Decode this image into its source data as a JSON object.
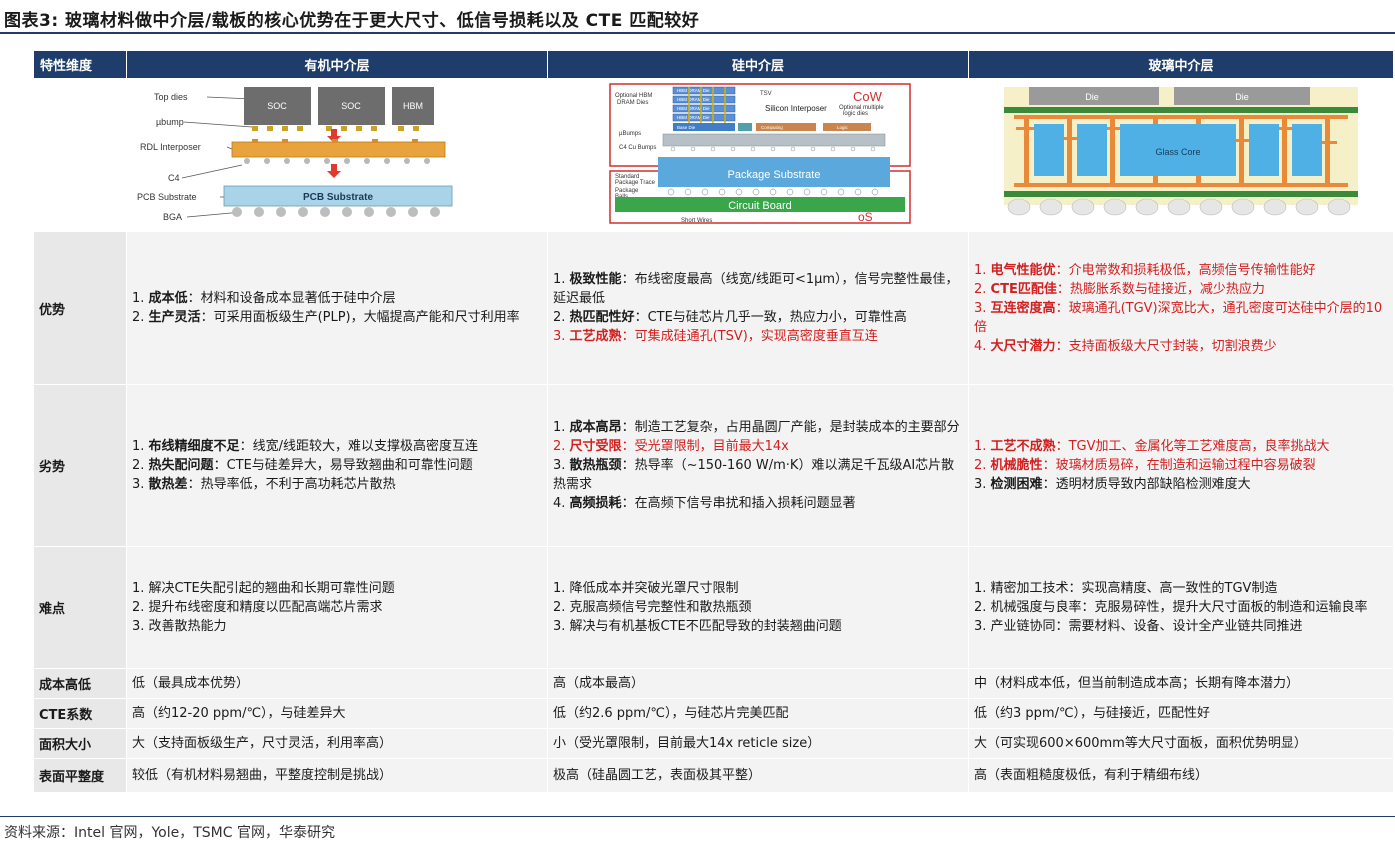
{
  "title": "图表3:  玻璃材料做中介层/载板的核心优势在于更大尺寸、低信号损耗以及 CTE 匹配较好",
  "columns": [
    "特性维度",
    "有机中介层",
    "硅中介层",
    "玻璃中介层"
  ],
  "diagrams": {
    "organic": {
      "top_dies": "Top dies",
      "ubump": "µbump",
      "rdl": "RDL Interposer",
      "c4": "C4",
      "pcb": "PCB Substrate",
      "bga": "BGA",
      "soc1": "SOC",
      "soc2": "SOC",
      "hbm": "HBM",
      "pcb_inner": "PCB Substrate"
    },
    "silicon": {
      "cow": "CoW",
      "os": "oS",
      "optional_hbm": "Optional HBM",
      "dram_dies": "DRAM Dies",
      "tsv": "TSV",
      "silicon_interposer": "Silicon Interposer",
      "optional_multiple": "Optional multiple",
      "logic_dies": "logic dies",
      "ubumps": "µBumps",
      "c4cu": "C4 Cu Bumps",
      "standard": "Standard",
      "package_trace": "Package Trace",
      "package": "Package",
      "balls": "Balls",
      "package_substrate": "Package Substrate",
      "circuit_board": "Circuit Board",
      "short_wires": "Short Wires",
      "hbm_dram_die": "HBM DRAM Die",
      "base_die": "Base Die",
      "computing": "Computing",
      "logic": "Logic"
    },
    "glass": {
      "die1": "Die",
      "die2": "Die",
      "glass_core": "Glass Core"
    }
  },
  "rows": [
    {
      "label": "优势",
      "organic": [
        [
          {
            "t": "1. "
          },
          {
            "t": "成本低",
            "b": true
          },
          {
            "t": "：材料和设备成本显著低于硅中介层"
          }
        ],
        [
          {
            "t": "2. "
          },
          {
            "t": "生产灵活",
            "b": true
          },
          {
            "t": "：可采用面板级生产(PLP)，大幅提高产能和尺寸利用率"
          }
        ]
      ],
      "silicon": [
        [
          {
            "t": "1. "
          },
          {
            "t": "极致性能",
            "b": true
          },
          {
            "t": "：布线密度最高（线宽/线距可<1μm），信号完整性最佳，延迟最低"
          }
        ],
        [
          {
            "t": "2. "
          },
          {
            "t": "热匹配性好",
            "b": true
          },
          {
            "t": "：CTE与硅芯片几乎一致，热应力小，可靠性高"
          }
        ],
        [
          {
            "t": "3. ",
            "r": true
          },
          {
            "t": "工艺成熟",
            "b": true,
            "r": true
          },
          {
            "t": "：可集成硅通孔(TSV)，实现高密度垂直互连",
            "r": true
          }
        ]
      ],
      "glass": [
        [
          {
            "t": "1. ",
            "r": true
          },
          {
            "t": "电气性能优",
            "b": true,
            "r": true
          },
          {
            "t": "：介电常数和损耗极低，高频信号传输性能好",
            "r": true
          }
        ],
        [
          {
            "t": "2. ",
            "r": true
          },
          {
            "t": "CTE匹配佳",
            "b": true,
            "r": true
          },
          {
            "t": "：热膨胀系数与硅接近，减少热应力",
            "r": true
          }
        ],
        [
          {
            "t": "3. ",
            "r": true
          },
          {
            "t": "互连密度高",
            "b": true,
            "r": true
          },
          {
            "t": "：玻璃通孔(TGV)深宽比大，通孔密度可达硅中介层的10倍",
            "r": true
          }
        ],
        [
          {
            "t": "4. ",
            "r": true
          },
          {
            "t": "大尺寸潜力",
            "b": true,
            "r": true
          },
          {
            "t": "：支持面板级大尺寸封装，切割浪费少",
            "r": true
          }
        ]
      ]
    },
    {
      "label": "劣势",
      "organic": [
        [
          {
            "t": "1. "
          },
          {
            "t": "布线精细度不足",
            "b": true
          },
          {
            "t": "：线宽/线距较大，难以支撑极高密度互连"
          }
        ],
        [
          {
            "t": "2. "
          },
          {
            "t": "热失配问题",
            "b": true
          },
          {
            "t": "：CTE与硅差异大，易导致翘曲和可靠性问题"
          }
        ],
        [
          {
            "t": "3. "
          },
          {
            "t": "散热差",
            "b": true
          },
          {
            "t": "：热导率低，不利于高功耗芯片散热"
          }
        ]
      ],
      "silicon": [
        [
          {
            "t": "1. "
          },
          {
            "t": "成本高昂",
            "b": true
          },
          {
            "t": "：制造工艺复杂，占用晶圆厂产能，是封装成本的主要部分"
          }
        ],
        [
          {
            "t": "2. ",
            "r": true
          },
          {
            "t": "尺寸受限",
            "b": true,
            "r": true
          },
          {
            "t": "：受光罩限制，目前最大14x",
            "r": true
          }
        ],
        [
          {
            "t": "3. "
          },
          {
            "t": "散热瓶颈",
            "b": true
          },
          {
            "t": "：热导率（~150-160 W/m·K）难以满足千瓦级AI芯片散热需求"
          }
        ],
        [
          {
            "t": "4. "
          },
          {
            "t": "高频损耗",
            "b": true
          },
          {
            "t": "：在高频下信号串扰和插入损耗问题显著"
          }
        ]
      ],
      "glass": [
        [
          {
            "t": "1. ",
            "r": true
          },
          {
            "t": "工艺不成熟",
            "b": true,
            "r": true
          },
          {
            "t": "：TGV加工、金属化等工艺难度高，良率挑战大",
            "r": true
          }
        ],
        [
          {
            "t": "2. ",
            "r": true
          },
          {
            "t": "机械脆性",
            "b": true,
            "r": true
          },
          {
            "t": "：玻璃材质易碎，在制造和运输过程中容易破裂",
            "r": true
          }
        ],
        [
          {
            "t": "3. "
          },
          {
            "t": "检测困难",
            "b": true
          },
          {
            "t": "：透明材质导致内部缺陷检测难度大"
          }
        ]
      ]
    },
    {
      "label": "难点",
      "organic": [
        [
          {
            "t": "1. 解决CTE失配引起的翘曲和长期可靠性问题"
          }
        ],
        [
          {
            "t": "2. 提升布线密度和精度以匹配高端芯片需求"
          }
        ],
        [
          {
            "t": "3. 改善散热能力"
          }
        ]
      ],
      "silicon": [
        [
          {
            "t": "1. 降低成本并突破光罩尺寸限制"
          }
        ],
        [
          {
            "t": "2. 克服高频信号完整性和散热瓶颈"
          }
        ],
        [
          {
            "t": "3. 解决与有机基板CTE不匹配导致的封装翘曲问题"
          }
        ]
      ],
      "glass": [
        [
          {
            "t": "1. 精密加工技术：实现高精度、高一致性的TGV制造"
          }
        ],
        [
          {
            "t": "2. 机械强度与良率：克服易碎性，提升大尺寸面板的制造和运输良率"
          }
        ],
        [
          {
            "t": "3. 产业链协同：需要材料、设备、设计全产业链共同推进"
          }
        ]
      ]
    },
    {
      "label": "成本高低",
      "organic": [
        [
          {
            "t": "低（最具成本优势）"
          }
        ]
      ],
      "silicon": [
        [
          {
            "t": "高（成本最高）"
          }
        ]
      ],
      "glass": [
        [
          {
            "t": "中（材料成本低，但当前制造成本高；长期有降本潜力）"
          }
        ]
      ]
    },
    {
      "label": "CTE系数",
      "organic": [
        [
          {
            "t": "高（约12-20 ppm/℃），与硅差异大"
          }
        ]
      ],
      "silicon": [
        [
          {
            "t": "低（约2.6 ppm/℃），与硅芯片完美匹配"
          }
        ]
      ],
      "glass": [
        [
          {
            "t": "低（约3 ppm/℃），与硅接近，匹配性好"
          }
        ]
      ]
    },
    {
      "label": "面积大小",
      "organic": [
        [
          {
            "t": "大（支持面板级生产，尺寸灵活，利用率高）"
          }
        ]
      ],
      "silicon": [
        [
          {
            "t": "小（受光罩限制，目前最大14x reticle size）"
          }
        ]
      ],
      "glass": [
        [
          {
            "t": "大（可实现600×600mm等大尺寸面板，面积优势明显）"
          }
        ]
      ]
    },
    {
      "label": "表面平整度",
      "organic": [
        [
          {
            "t": "较低（有机材料易翘曲，平整度控制是挑战）"
          }
        ]
      ],
      "silicon": [
        [
          {
            "t": "极高（硅晶圆工艺，表面极其平整）"
          }
        ]
      ],
      "glass": [
        [
          {
            "t": "高（表面粗糙度极低，有利于精细布线）"
          }
        ]
      ]
    }
  ],
  "source": "资料来源：Intel 官网，Yole，TSMC 官网，华泰研究"
}
